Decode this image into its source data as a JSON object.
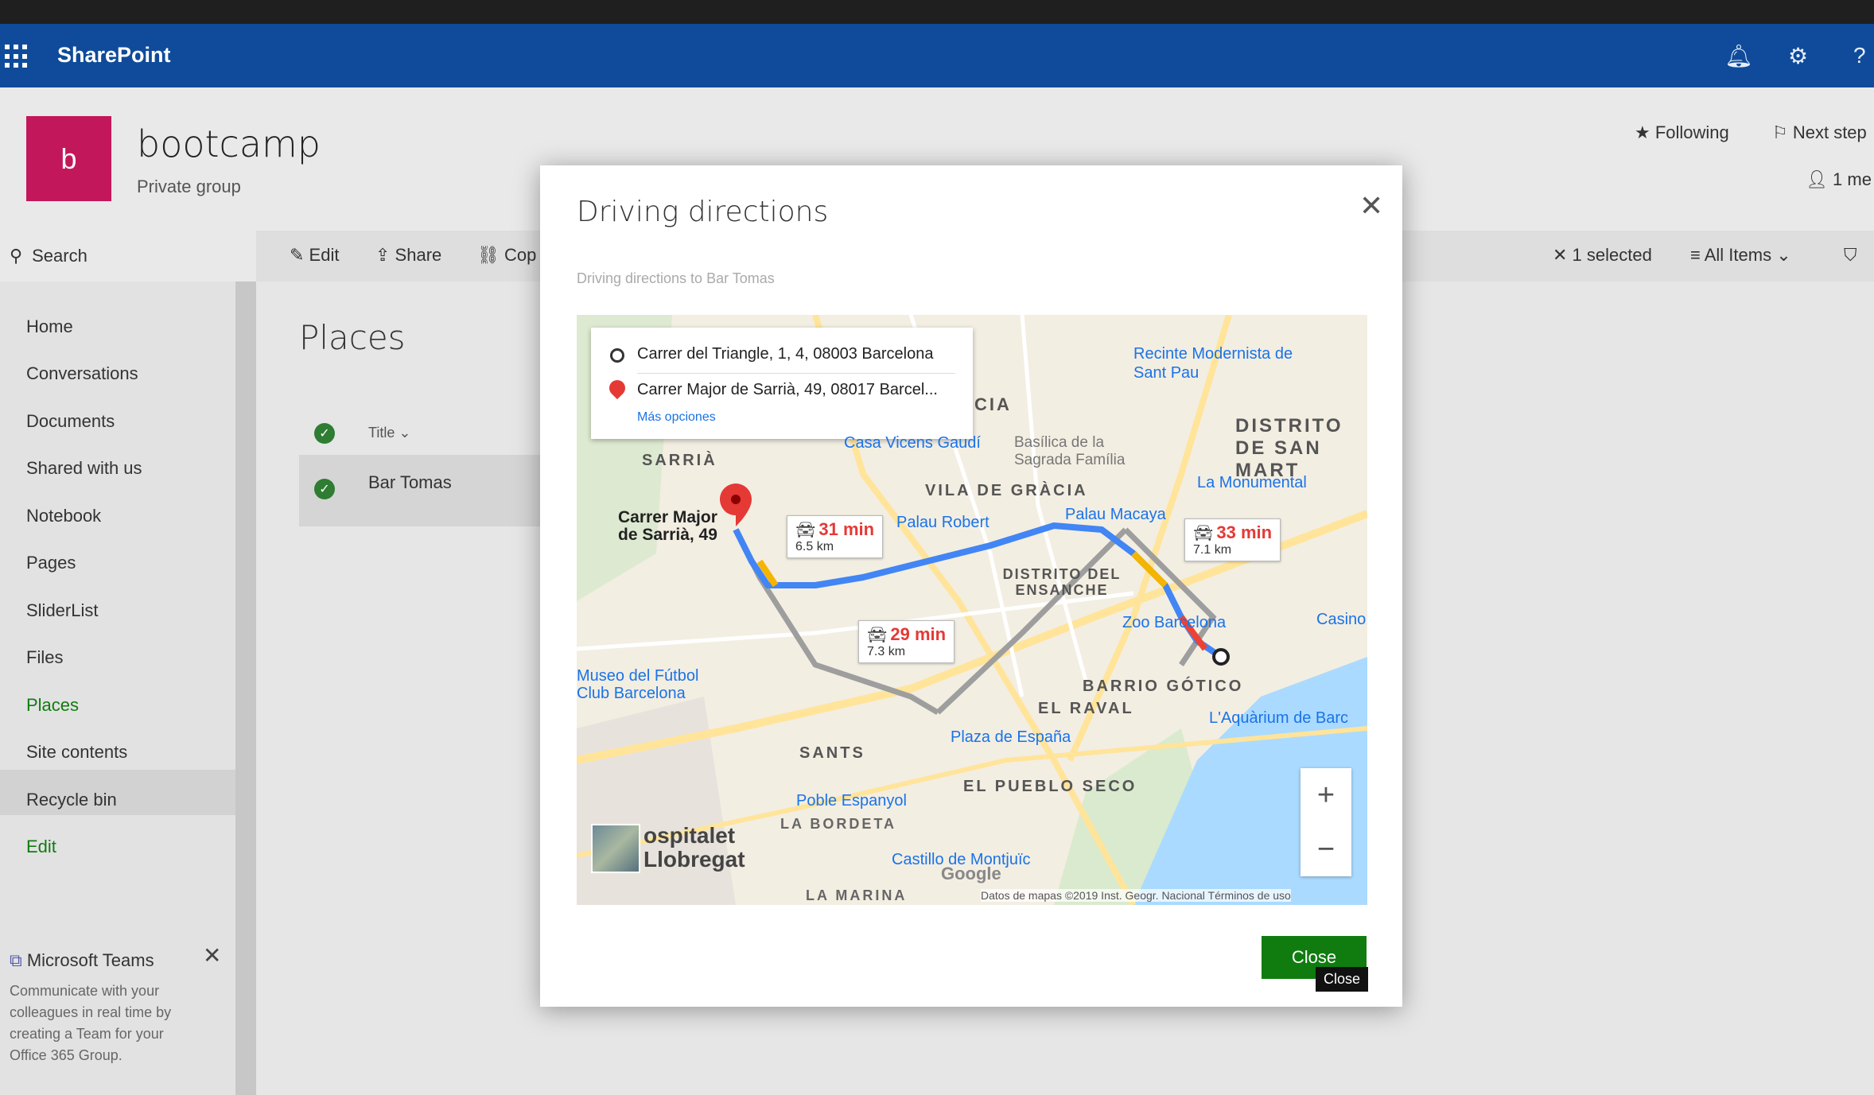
{
  "suite": {
    "brand": "SharePoint"
  },
  "group": {
    "logo_letter": "b",
    "name": "bootcamp",
    "type": "Private group",
    "following": "Following",
    "next_steps": "Next step",
    "members": "1 me"
  },
  "command": {
    "search": "Search",
    "edit": "Edit",
    "share": "Share",
    "copy": "Cop",
    "selected": "1 selected",
    "view": "All Items"
  },
  "nav": {
    "items": [
      "Home",
      "Conversations",
      "Documents",
      "Shared with us",
      "Notebook",
      "Pages",
      "SliderList",
      "Files",
      "Places",
      "Site contents",
      "Recycle bin",
      "Edit"
    ]
  },
  "teams": {
    "title": "Microsoft Teams",
    "body": "Communicate with your colleagues in real time by creating a Team for your Office 365 Group."
  },
  "list": {
    "title": "Places",
    "column": "Title",
    "row": "Bar Tomas"
  },
  "modal": {
    "title": "Driving directions",
    "subtitle": "Driving directions to Bar Tomas",
    "close_label": "Close",
    "tooltip": "Close"
  },
  "map": {
    "from": "Carrer del Triangle, 1, 4, 08003 Barcelona",
    "to": "Carrer Major de Sarrià, 49, 08017 Barcel...",
    "options": "Más opciones",
    "routes": [
      {
        "time": "31 min",
        "dist": "6.5 km"
      },
      {
        "time": "29 min",
        "dist": "7.3 km"
      },
      {
        "time": "33 min",
        "dist": "7.1 km"
      }
    ],
    "labels": {
      "sarria": "SARRIÀ",
      "gracia": "VILA DE GRÀCIA",
      "eixample": "DISTRITO DEL ENSANCHE",
      "gotic": "BARRIO GÓTICO",
      "raval": "EL RAVAL",
      "sants": "SANTS",
      "poble_sec": "EL PUEBLO SECO",
      "bordeta": "LA BORDETA",
      "marina": "LA MARINA",
      "sant_marti": "DISTRITO DE SAN MART",
      "cia": "CIA",
      "destination": "Carrer Major de Sarrià, 49",
      "hospitalet": "ospitalet Llobregat"
    },
    "pois": [
      "Recinte Modernista de Sant Pau",
      "Casa Vicens Gaudí",
      "Basílica de la Sagrada Família",
      "La Monumental",
      "Palau Robert",
      "Palau Macaya",
      "Zoo Barcelona",
      "Casino",
      "Museo del Fútbol Club Barcelona",
      "Plaza de España",
      "Poble Espanyol",
      "Castillo de Montjuïc",
      "L'Aquàrium de Barc"
    ],
    "attribution": "Datos de mapas ©2019 Inst. Geogr. Nacional   Términos de uso",
    "google": "Google"
  },
  "colors": {
    "suitebar": "#0f4b9a",
    "group_logo": "#c2185b",
    "close_button": "#107c10",
    "route_main": "#4285f4",
    "route_alt": "#9e9e9e"
  }
}
